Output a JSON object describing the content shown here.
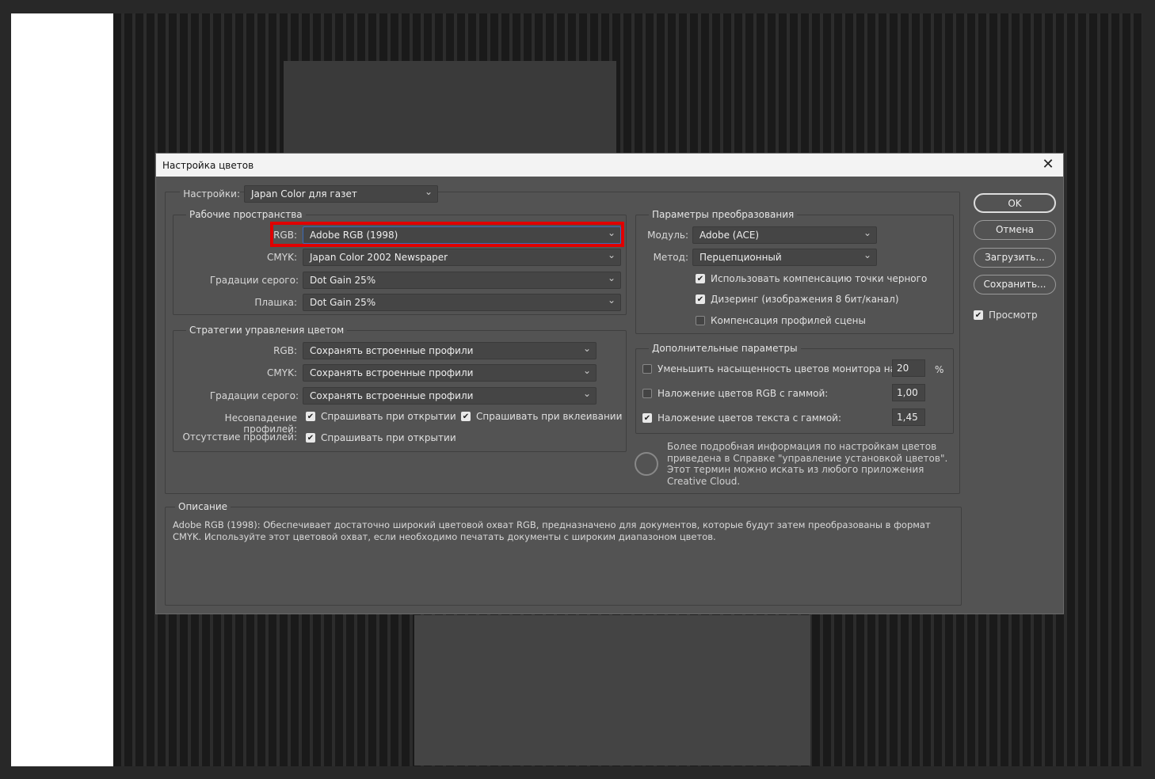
{
  "dialog": {
    "title": "Настройка цветов",
    "settings": {
      "label": "Настройки:",
      "value": "Japan Color для газет"
    },
    "working_spaces": {
      "title": "Рабочие пространства",
      "rows": [
        {
          "label": "RGB:",
          "value": "Adobe RGB (1998)"
        },
        {
          "label": "CMYK:",
          "value": "Japan Color 2002 Newspaper"
        },
        {
          "label": "Градации серого:",
          "value": "Dot Gain 25%"
        },
        {
          "label": "Плашка:",
          "value": "Dot Gain 25%"
        }
      ]
    },
    "policies": {
      "title": "Стратегии управления цветом",
      "rows": [
        {
          "label": "RGB:",
          "value": "Сохранять встроенные профили"
        },
        {
          "label": "CMYK:",
          "value": "Сохранять встроенные профили"
        },
        {
          "label": "Градации серого:",
          "value": "Сохранять встроенные профили"
        }
      ],
      "mismatch_label": "Несовпадение профилей:",
      "mismatch_open": "Спрашивать при открытии",
      "mismatch_paste": "Спрашивать при вклеивании",
      "missing_label": "Отсутствие профилей:",
      "missing_open": "Спрашивать при открытии"
    },
    "conversion": {
      "title": "Параметры преобразования",
      "engine_label": "Модуль:",
      "engine": "Adobe (ACE)",
      "intent_label": "Метод:",
      "intent": "Перцепционный",
      "bpc": "Использовать компенсацию точки черного",
      "dither": "Дизеринг (изображения 8 бит/канал)",
      "scene": "Компенсация профилей сцены"
    },
    "advanced": {
      "title": "Дополнительные параметры",
      "desat": "Уменьшить насыщенность цветов монитора на:",
      "desat_value": "20",
      "percent": "%",
      "blend_rgb": "Наложение цветов RGB с гаммой:",
      "blend_rgb_value": "1,00",
      "blend_text": "Наложение цветов текста с гаммой:",
      "blend_text_value": "1,45"
    },
    "info": "Более подробная информация по настройкам цветов приведена в Справке \"управление установкой цветов\". Этот термин можно искать из любого приложения Creative Cloud.",
    "description": {
      "title": "Описание",
      "text": "Adobe RGB (1998):  Обеспечивает достаточно широкий цветовой охват RGB, предназначено для документов, которые будут затем преобразованы в формат CMYK. Используйте этот цветовой охват, если необходимо печатать документы с широким диапазоном цветов."
    },
    "buttons": {
      "ok": "OK",
      "cancel": "Отмена",
      "load": "Загрузить...",
      "save": "Сохранить...",
      "preview": "Просмотр"
    },
    "highlight_color": "#e00000"
  }
}
